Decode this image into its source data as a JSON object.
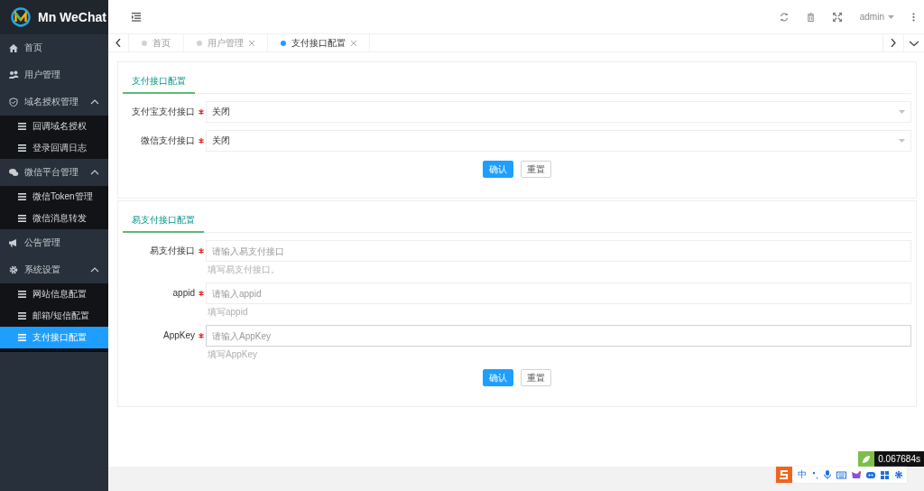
{
  "sidebar": {
    "logo": "Mn WeChat",
    "items": [
      {
        "label": "首页",
        "selected": false
      },
      {
        "label": "用户管理",
        "selected": false
      },
      {
        "label": "域名授权管理",
        "selected": false,
        "expanded": true,
        "children": [
          {
            "label": "回调域名授权",
            "selected": false
          },
          {
            "label": "登录回调日志",
            "selected": false
          }
        ]
      },
      {
        "label": "微信平台管理",
        "selected": false,
        "expanded": true,
        "children": [
          {
            "label": "微信Token管理",
            "selected": false
          },
          {
            "label": "微信消息转发",
            "selected": false
          }
        ]
      },
      {
        "label": "公告管理",
        "selected": false
      },
      {
        "label": "系统设置",
        "selected": false,
        "expanded": true,
        "children": [
          {
            "label": "网站信息配置",
            "selected": false
          },
          {
            "label": "邮箱/短信配置",
            "selected": false
          },
          {
            "label": "支付接口配置",
            "selected": true
          }
        ]
      }
    ]
  },
  "header": {
    "user": "admin"
  },
  "tabs": [
    {
      "label": "首页",
      "selected": false,
      "closable": false
    },
    {
      "label": "用户管理",
      "selected": false,
      "closable": true
    },
    {
      "label": "支付接口配置",
      "selected": true,
      "closable": true
    }
  ],
  "cards": [
    {
      "tab": "支付接口配置",
      "fields": [
        {
          "kind": "select",
          "label": "支付宝支付接口",
          "required": true,
          "value": "关闭"
        },
        {
          "kind": "select",
          "label": "微信支付接口",
          "required": true,
          "value": "关闭"
        }
      ],
      "buttons": [
        "确认",
        "重置"
      ]
    },
    {
      "tab": "易支付接口配置",
      "fields": [
        {
          "kind": "input",
          "label": "易支付接口",
          "required": true,
          "placeholder": "请输入易支付接口",
          "hint": "填写易支付接口。",
          "focused": false
        },
        {
          "kind": "input",
          "label": "appid",
          "required": true,
          "placeholder": "请输入appid",
          "hint": "填写appid",
          "focused": false
        },
        {
          "kind": "input",
          "label": "AppKey",
          "required": true,
          "placeholder": "请输入AppKey",
          "hint": "填写AppKey",
          "focused": true
        }
      ],
      "buttons": [
        "确认",
        "重置"
      ]
    }
  ],
  "overlay": {
    "timer": "0.067684s",
    "ime": "中"
  }
}
